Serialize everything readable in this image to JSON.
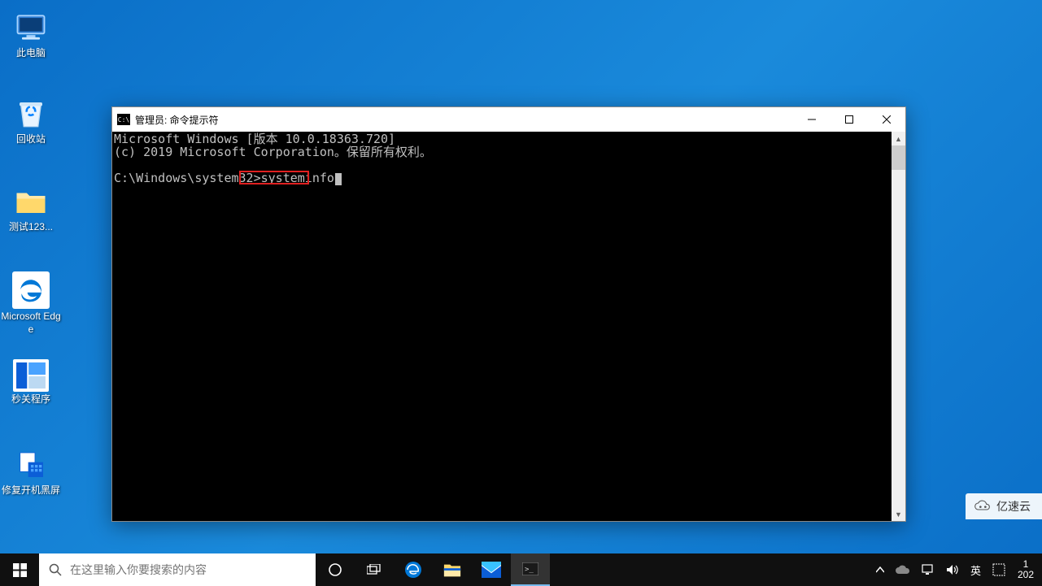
{
  "desktop_icons": {
    "this_pc": "此电脑",
    "recycle_bin": "回收站",
    "test_folder": "测试123...",
    "edge": "Microsoft Edge",
    "sec_close": "秒关程序",
    "fix_boot": "修复开机黑屏"
  },
  "cmd": {
    "title": "管理员: 命令提示符",
    "line1": "Microsoft Windows [版本 10.0.18363.720]",
    "line2": "(c) 2019 Microsoft Corporation。保留所有权利。",
    "prompt": "C:\\Windows\\system32>",
    "command": "systeminfo"
  },
  "taskbar": {
    "search_placeholder": "在这里输入你要搜索的内容",
    "ime_lang": "英",
    "tray_chevron": "^",
    "time_line1": "1",
    "time_line2": "202"
  },
  "watermark": {
    "text": "亿速云"
  }
}
